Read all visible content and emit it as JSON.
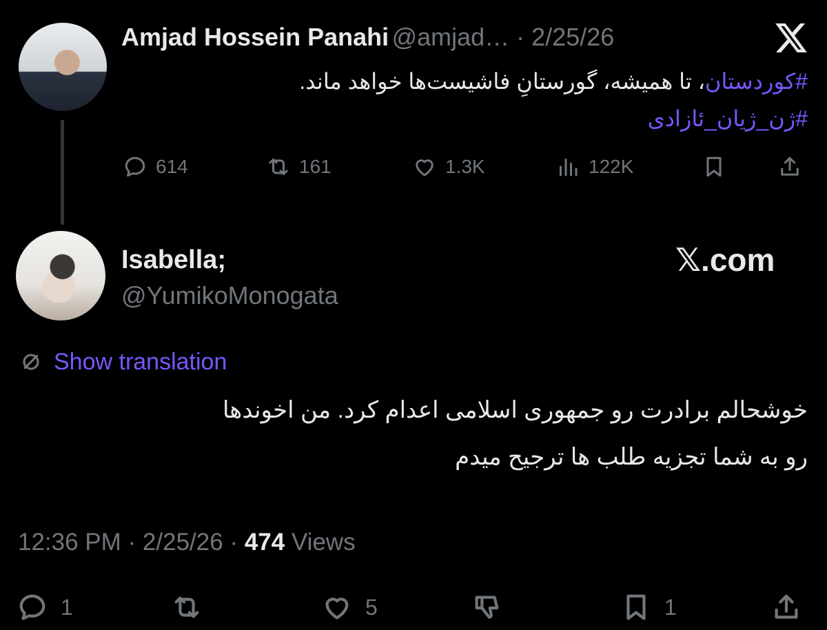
{
  "tweet_parent": {
    "author_name": "Amjad Hossein Panahi",
    "author_handle": "@amjad…",
    "separator": " · ",
    "date": "2/25/26",
    "text_line1_hashtag": "#کوردستان",
    "text_line1_rest": "، تا همیشه، گورستانِ فاشیست‌ها خواهد ماند.",
    "text_line2_hashtag": "#ژن_ژیان_ئازادی",
    "replies": "614",
    "reposts": "161",
    "likes": "1.3K",
    "views": "122K"
  },
  "tweet_reply": {
    "author_name": "Isabella;",
    "author_handle": "@YumikoMonogata",
    "watermark": "𝕏.com",
    "show_translation": "Show translation",
    "text_line1": "خوشحالم برادرت رو جمهوری اسلامی اعدام کرد. من اخوندها",
    "text_line2": "رو به شما تجزیه طلب ها ترجیح میدم",
    "time": "12:36 PM",
    "date": "2/25/26",
    "views_count": "474",
    "views_label": "Views",
    "replies": "1",
    "reposts": "",
    "likes": "5",
    "bookmarks": "1"
  },
  "colors": {
    "background": "#000000",
    "text": "#e7e9ea",
    "muted": "#71767b",
    "accent": "#7856ff",
    "thread_line": "#333639"
  },
  "icons": [
    "x-logo-icon",
    "reply-icon",
    "repost-icon",
    "like-icon",
    "views-icon",
    "bookmark-icon",
    "share-icon",
    "translate-icon",
    "dislike-icon"
  ]
}
